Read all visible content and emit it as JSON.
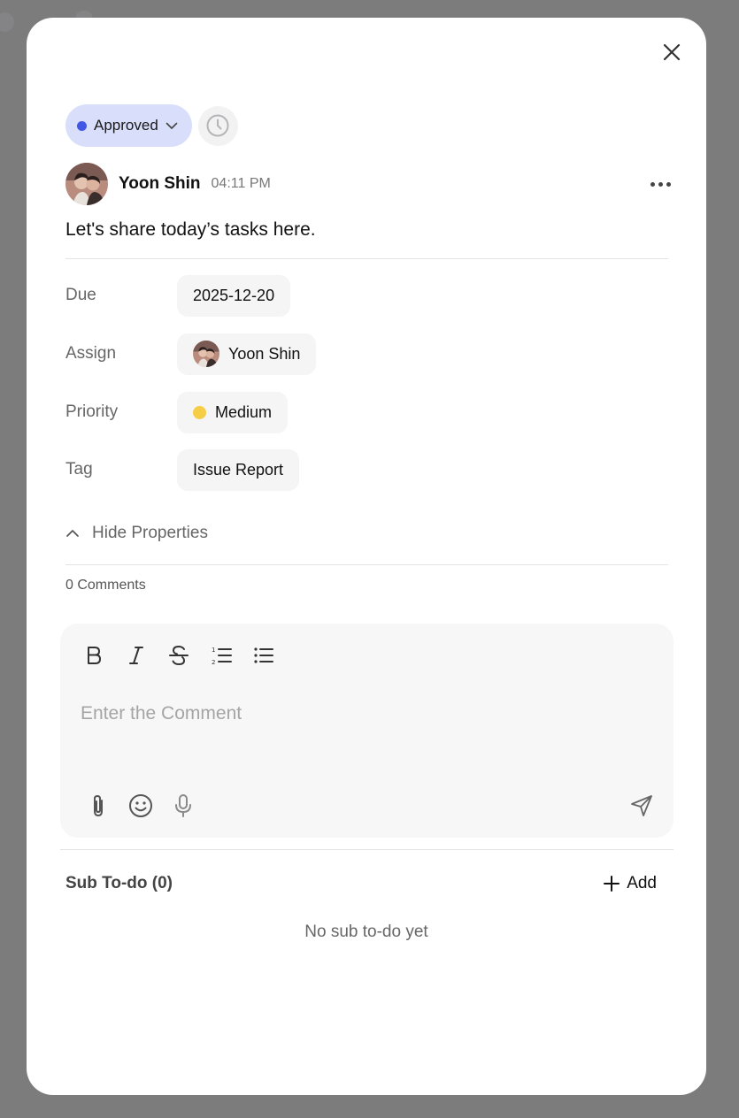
{
  "status": {
    "label": "Approved",
    "color": "#3f58e6"
  },
  "author": {
    "name": "Yoon Shin",
    "time": "04:11 PM"
  },
  "task": {
    "text": "Let's share today’s tasks here."
  },
  "properties": {
    "due": {
      "label": "Due",
      "value": "2025-12-20"
    },
    "assign": {
      "label": "Assign",
      "value": "Yoon Shin"
    },
    "priority": {
      "label": "Priority",
      "value": "Medium",
      "color": "#f5ce46"
    },
    "tag": {
      "label": "Tag",
      "value": "Issue Report"
    }
  },
  "toggle": {
    "label": "Hide Properties"
  },
  "comments": {
    "count_label": "0 Comments",
    "placeholder": "Enter the Comment"
  },
  "subtodo": {
    "title": "Sub To-do (0)",
    "add_label": "Add",
    "empty_text": "No sub to-do yet"
  },
  "icons": [
    "close-icon",
    "chevron-down-icon",
    "clock-icon",
    "more-icon",
    "chevron-up-icon",
    "bold-icon",
    "italic-icon",
    "strikethrough-icon",
    "numbered-list-icon",
    "bullet-list-icon",
    "paperclip-icon",
    "emoji-icon",
    "microphone-icon",
    "send-icon",
    "plus-icon"
  ]
}
